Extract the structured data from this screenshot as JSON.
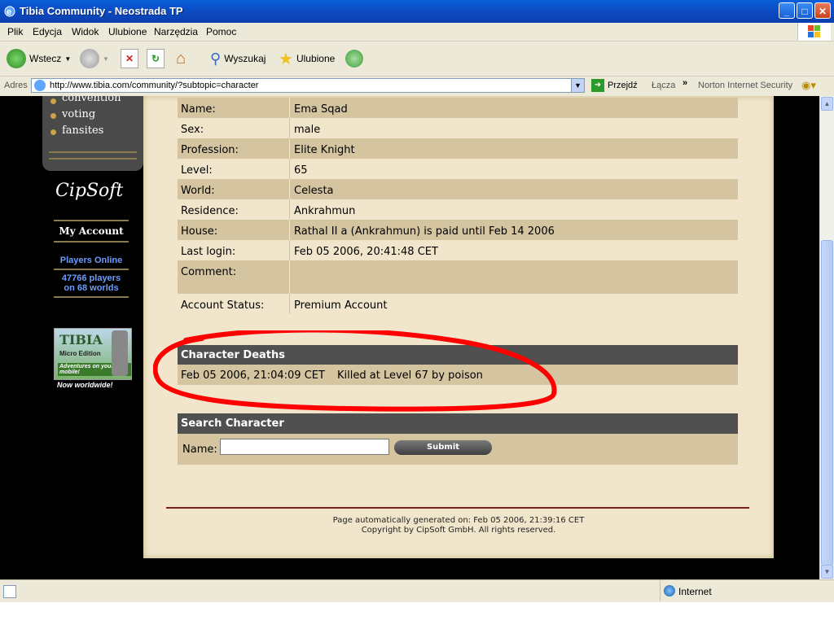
{
  "window": {
    "title": "Tibia Community - Neostrada TP",
    "buttons": {
      "minimize": "_",
      "maximize": "□",
      "close": "✕"
    }
  },
  "menu": [
    "Plik",
    "Edycja",
    "Widok",
    "Ulubione",
    "Narzędzia",
    "Pomoc"
  ],
  "toolbar": {
    "back_label": "Wstecz",
    "search_label": "Wyszukaj",
    "favorites_label": "Ulubione"
  },
  "address": {
    "label": "Adres",
    "url": "http://www.tibia.com/community/?subtopic=character",
    "go_label": "Przejdź",
    "links_label": "Łącza",
    "norton_label": "Norton Internet Security"
  },
  "sidebar": {
    "links": [
      "convention",
      "voting",
      "fansites"
    ],
    "cipsoft": "CipSoft",
    "my_account": "My Account",
    "players_online_title": "Players Online",
    "players_count": "47766 players",
    "worlds_count": "on 68 worlds",
    "tibiame_title": "TIBIA",
    "tibiame_sub": "Micro Edition",
    "tibiame_tag": "Adventures on your mobile!",
    "worldwide": "Now worldwide!"
  },
  "character": {
    "rows": [
      {
        "label": "Name:",
        "value": "Ema Sqad"
      },
      {
        "label": "Sex:",
        "value": "male"
      },
      {
        "label": "Profession:",
        "value": "Elite Knight"
      },
      {
        "label": "Level:",
        "value": "65"
      },
      {
        "label": "World:",
        "value": "Celesta"
      },
      {
        "label": "Residence:",
        "value": "Ankrahmun"
      },
      {
        "label": "House:",
        "value": "Rathal II a (Ankrahmun) is paid until Feb 14 2006"
      },
      {
        "label": "Last login:",
        "value": "Feb 05 2006, 20:41:48 CET"
      },
      {
        "label": "Comment:",
        "value": ""
      },
      {
        "label": "Account Status:",
        "value": "Premium Account"
      }
    ]
  },
  "deaths": {
    "title": "Character Deaths",
    "date": "Feb 05 2006, 21:04:09 CET",
    "desc": "Killed at Level 67 by poison"
  },
  "search": {
    "title": "Search Character",
    "name_label": "Name:",
    "input_value": "",
    "submit_label": "Submit"
  },
  "footer": {
    "generated": "Page automatically generated on: Feb 05 2006, 21:39:16 CET",
    "copyright": "Copyright by CipSoft GmbH. All rights reserved."
  },
  "status": {
    "zone": "Internet"
  },
  "colors": {
    "parchment": "#f1e6cc",
    "row_dark": "#d4c4a0",
    "header": "#505050",
    "annotation": "#ff0000"
  }
}
